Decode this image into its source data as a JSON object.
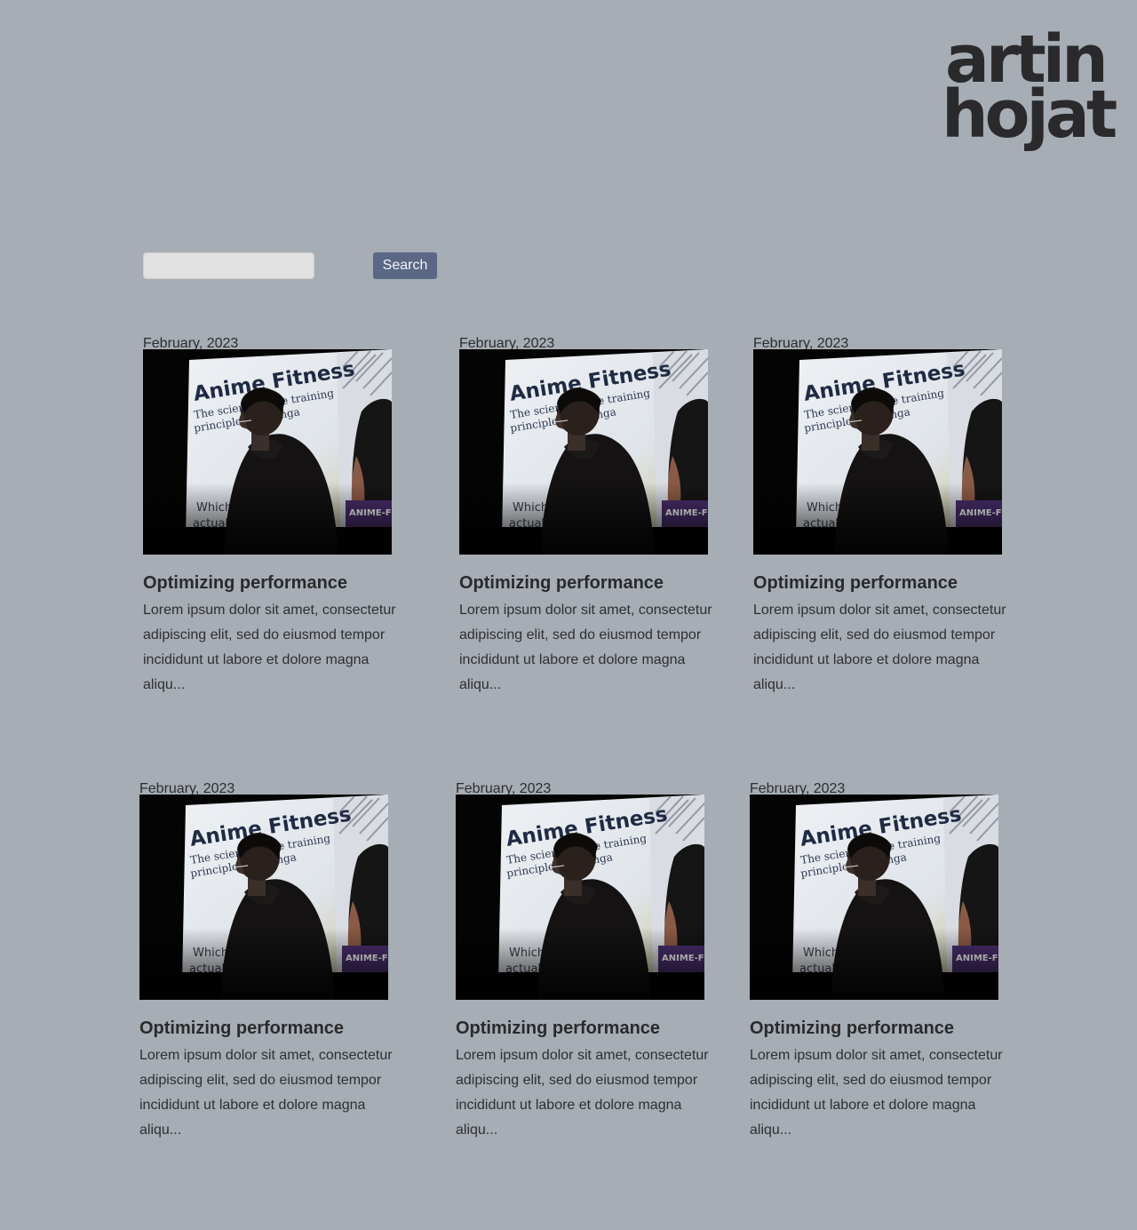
{
  "logo": {
    "line1": "artin",
    "line2": "hojat"
  },
  "search": {
    "input_value": "",
    "placeholder": "",
    "button_label": "Search"
  },
  "image_text": {
    "headline": "Anime Fitness",
    "subline1": "The science b   the training",
    "subline2": "principles in    manga",
    "corner1": "Which",
    "corner2": "actuall",
    "banner": "ANIME-FI"
  },
  "posts": [
    {
      "date": "February, 2023",
      "title": "Optimizing performance",
      "excerpt": "Lorem ipsum dolor sit amet, consectetur adipiscing elit, sed do eiusmod tempor incididunt ut labore et dolore magna aliqu..."
    },
    {
      "date": "February, 2023",
      "title": "Optimizing performance",
      "excerpt": "Lorem ipsum dolor sit amet, consectetur adipiscing elit, sed do eiusmod tempor incididunt ut labore et dolore magna aliqu..."
    },
    {
      "date": "February, 2023",
      "title": "Optimizing performance",
      "excerpt": "Lorem ipsum dolor sit amet, consectetur adipiscing elit, sed do eiusmod tempor incididunt ut labore et dolore magna aliqu..."
    },
    {
      "date": "February, 2023",
      "title": "Optimizing performance",
      "excerpt": "Lorem ipsum dolor sit amet, consectetur adipiscing elit, sed do eiusmod tempor incididunt ut labore et dolore magna aliqu..."
    },
    {
      "date": "February, 2023",
      "title": "Optimizing performance",
      "excerpt": "Lorem ipsum dolor sit amet, consectetur adipiscing elit, sed do eiusmod tempor incididunt ut labore et dolore magna aliqu..."
    },
    {
      "date": "February, 2023",
      "title": "Optimizing performance",
      "excerpt": "Lorem ipsum dolor sit amet, consectetur adipiscing elit, sed do eiusmod tempor incididunt ut labore et dolore magna aliqu..."
    }
  ],
  "colors": {
    "background": "#a6adb4",
    "search_button": "#5a6886",
    "text": "#2b2b2d"
  }
}
